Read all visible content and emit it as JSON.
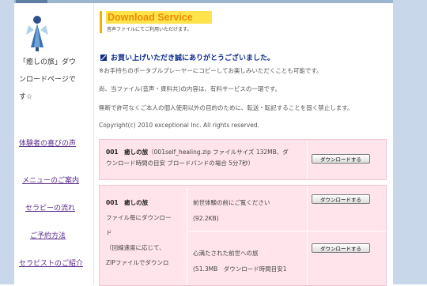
{
  "colors": {
    "accent_title": "#f28a00",
    "title_bg": "#ffe34d",
    "link": "#5a2a8c",
    "heading": "#0d2c8c",
    "table_bg": "#ffe4ec"
  },
  "sidebar": {
    "tagline_lines": [
      "「癒しの旅」ダウ",
      "ンロードページで",
      "す☆"
    ],
    "links": [
      "体験者の喜びの声",
      "メニューのご案内",
      "セラピーの流れ",
      "ご予約方法",
      "セラピストのご紹介"
    ]
  },
  "header": {
    "title": "Download Service",
    "subtitle": "音声ファイルにてご利用いただけます。"
  },
  "main": {
    "thanks": "お買い上げいただき誠にありがとうございました。",
    "paragraphs": [
      "※お手持ちのポータブルプレーヤーにコピーしてお楽しみいただくことも可能です。",
      "尚、当ファイル(音声・資料共)の内容は、有料サービスの一環です。",
      "無断で許可なくご本人の個人使用以外の目的のために、転送・転記することを固く禁止します。",
      "Copyright(c) 2010 exceptional Inc. All rights reserved."
    ]
  },
  "downloads": {
    "button_label": "ダウンロードする",
    "item1": {
      "title": "001　癒しの旅",
      "line1_rest": "（001self_healing.zip ファイルサイズ 132MB、ダ",
      "line2": "ウンロード時間の目安 ブロードバンドの場合 5分7秒）"
    },
    "item2": {
      "title": "001　癒しの旅",
      "left_lines": [
        "ファイル毎にダウンロー",
        "ド",
        "（回線速度に応じて、",
        "ZIPファイルでダウンロ"
      ],
      "files": [
        {
          "name": "前世体験の前にご覧ください",
          "size": "(92.2KB)"
        },
        {
          "name": "心満たされた前世への旅",
          "size": "(51.3MB　ダウンロード時間目安1"
        }
      ]
    }
  }
}
